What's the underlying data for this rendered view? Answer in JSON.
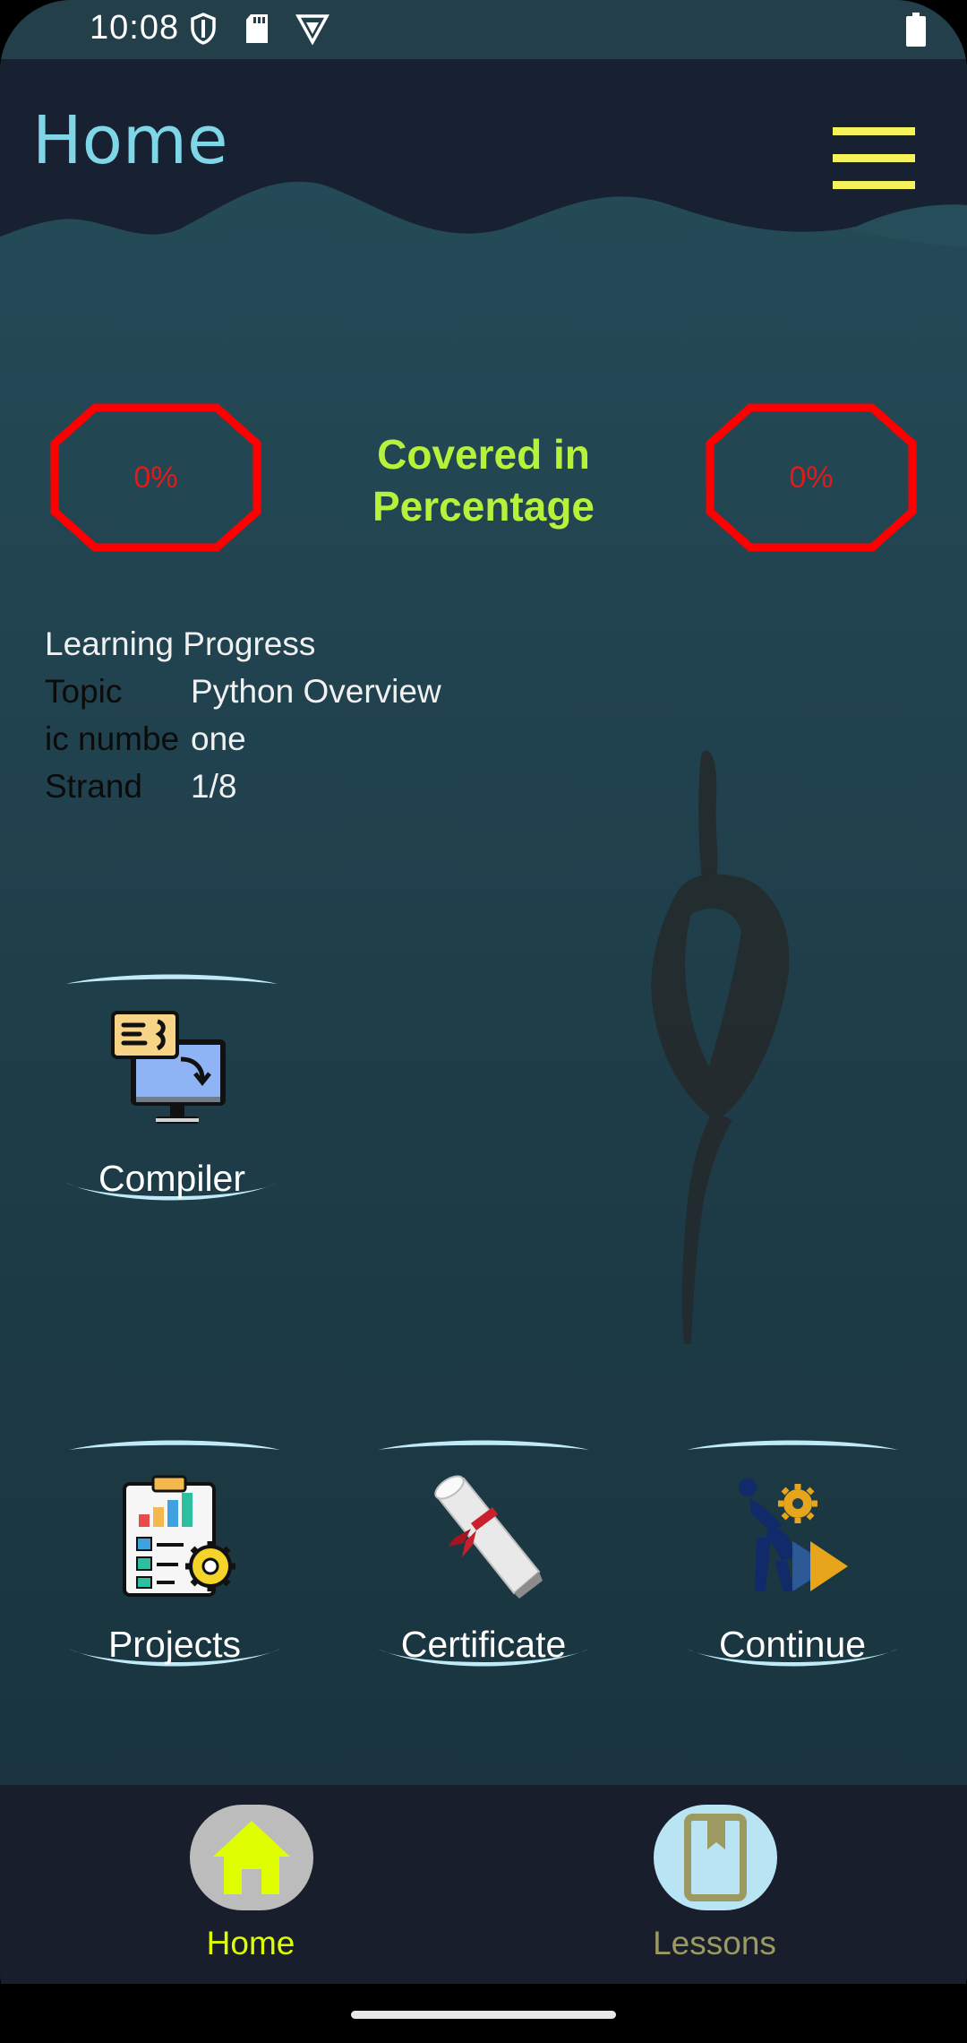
{
  "status_bar": {
    "time": "10:08",
    "icons": [
      "shield-icon",
      "sd-card-icon",
      "vpn-icon",
      "battery-icon"
    ]
  },
  "header": {
    "title": "Home",
    "menu_icon": "hamburger-menu-icon",
    "accent_color": "#f4f45a",
    "title_color": "#7fd6e6"
  },
  "progress": {
    "left_percent": "0%",
    "right_percent": "0%",
    "covered_label": "Covered in Percentage",
    "label_color": "#b6f23c",
    "octagon_color": "#ff0000"
  },
  "learning_progress": {
    "heading": "Learning Progress",
    "rows": [
      {
        "label": "Topic",
        "value": "Python Overview"
      },
      {
        "label": "ic numbe",
        "value": "one"
      },
      {
        "label": "Strand",
        "value": "1/8"
      }
    ]
  },
  "tiles": [
    {
      "label": "Compiler",
      "icon": "compiler-computer-icon"
    },
    {
      "label": "Projects",
      "icon": "project-clipboard-icon"
    },
    {
      "label": "Certificate",
      "icon": "certificate-scroll-icon"
    },
    {
      "label": "Continue",
      "icon": "continue-worker-icon"
    }
  ],
  "bottom_nav": {
    "items": [
      {
        "label": "Home",
        "icon": "home-icon",
        "active": true,
        "color": "#dfff00"
      },
      {
        "label": "Lessons",
        "icon": "book-icon",
        "active": false,
        "color": "#9c9a60"
      }
    ]
  }
}
